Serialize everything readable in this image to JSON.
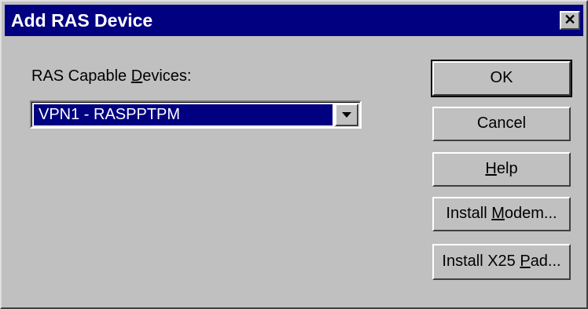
{
  "window": {
    "title": "Add RAS Device",
    "close_glyph": "✕"
  },
  "devices": {
    "label_pre": "RAS Capable ",
    "label_mnemonic": "D",
    "label_post": "evices:",
    "selected_value": "VPN1 - RASPPTPM"
  },
  "buttons": {
    "ok": "OK",
    "cancel": "Cancel",
    "help_mnemonic": "H",
    "help_post": "elp",
    "modem_pre": "Install ",
    "modem_mnemonic": "M",
    "modem_post": "odem...",
    "x25_pre": "Install X25 ",
    "x25_mnemonic": "P",
    "x25_post": "ad..."
  },
  "icons": {
    "close": "close-icon",
    "dropdown": "chevron-down-icon"
  },
  "colors": {
    "titlebar": "#000080",
    "selection": "#000080",
    "face": "#c0c0c0"
  }
}
